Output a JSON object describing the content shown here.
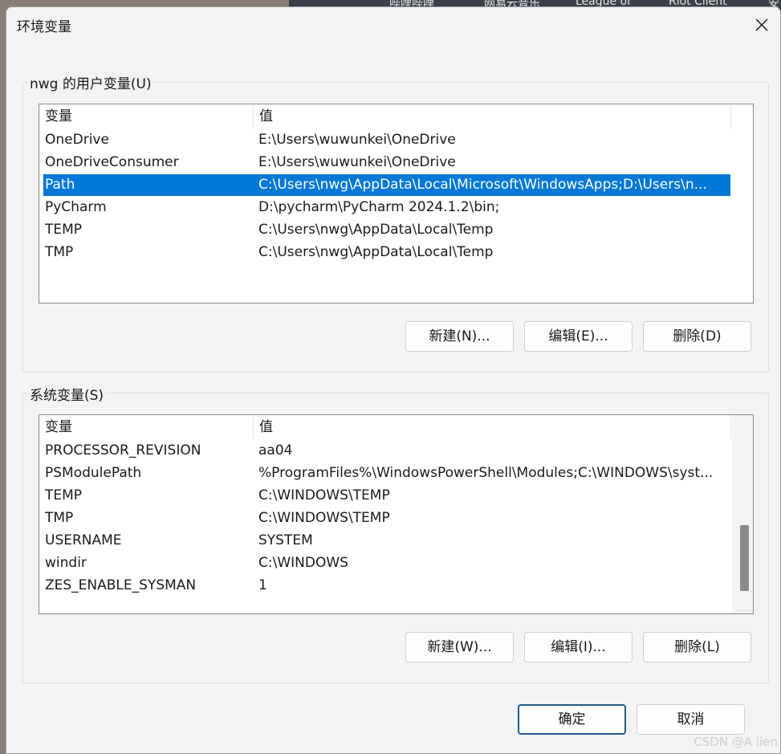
{
  "background": {
    "taskbar_labels": [
      "哔哩哔哩",
      "网易云音乐",
      "League of",
      "Riot Client",
      "安"
    ]
  },
  "dialog": {
    "title": "环境变量",
    "close_icon": "close-icon"
  },
  "user_vars": {
    "group_label": "nwg 的用户变量(U)",
    "columns": [
      "变量",
      "值"
    ],
    "rows": [
      {
        "name": "OneDrive",
        "value": "E:\\Users\\wuwunkei\\OneDrive",
        "selected": false
      },
      {
        "name": "OneDriveConsumer",
        "value": "E:\\Users\\wuwunkei\\OneDrive",
        "selected": false
      },
      {
        "name": "Path",
        "value": "C:\\Users\\nwg\\AppData\\Local\\Microsoft\\WindowsApps;D:\\Users\\n...",
        "selected": true
      },
      {
        "name": "PyCharm",
        "value": "D:\\pycharm\\PyCharm 2024.1.2\\bin;",
        "selected": false
      },
      {
        "name": "TEMP",
        "value": "C:\\Users\\nwg\\AppData\\Local\\Temp",
        "selected": false
      },
      {
        "name": "TMP",
        "value": "C:\\Users\\nwg\\AppData\\Local\\Temp",
        "selected": false
      }
    ],
    "buttons": {
      "new": "新建(N)...",
      "edit": "编辑(E)...",
      "delete": "删除(D)"
    }
  },
  "system_vars": {
    "group_label": "系统变量(S)",
    "columns": [
      "变量",
      "值"
    ],
    "rows": [
      {
        "name": "PROCESSOR_REVISION",
        "value": "aa04"
      },
      {
        "name": "PSModulePath",
        "value": "%ProgramFiles%\\WindowsPowerShell\\Modules;C:\\WINDOWS\\syst..."
      },
      {
        "name": "TEMP",
        "value": "C:\\WINDOWS\\TEMP"
      },
      {
        "name": "TMP",
        "value": "C:\\WINDOWS\\TEMP"
      },
      {
        "name": "USERNAME",
        "value": "SYSTEM"
      },
      {
        "name": "windir",
        "value": "C:\\WINDOWS"
      },
      {
        "name": "ZES_ENABLE_SYSMAN",
        "value": "1"
      }
    ],
    "buttons": {
      "new": "新建(W)...",
      "edit": "编辑(I)...",
      "delete": "删除(L)"
    }
  },
  "footer": {
    "ok": "确定",
    "cancel": "取消"
  },
  "watermark": "CSDN @A lien",
  "colors": {
    "selection": "#0078d7",
    "primary_border": "#1f5a8c"
  }
}
